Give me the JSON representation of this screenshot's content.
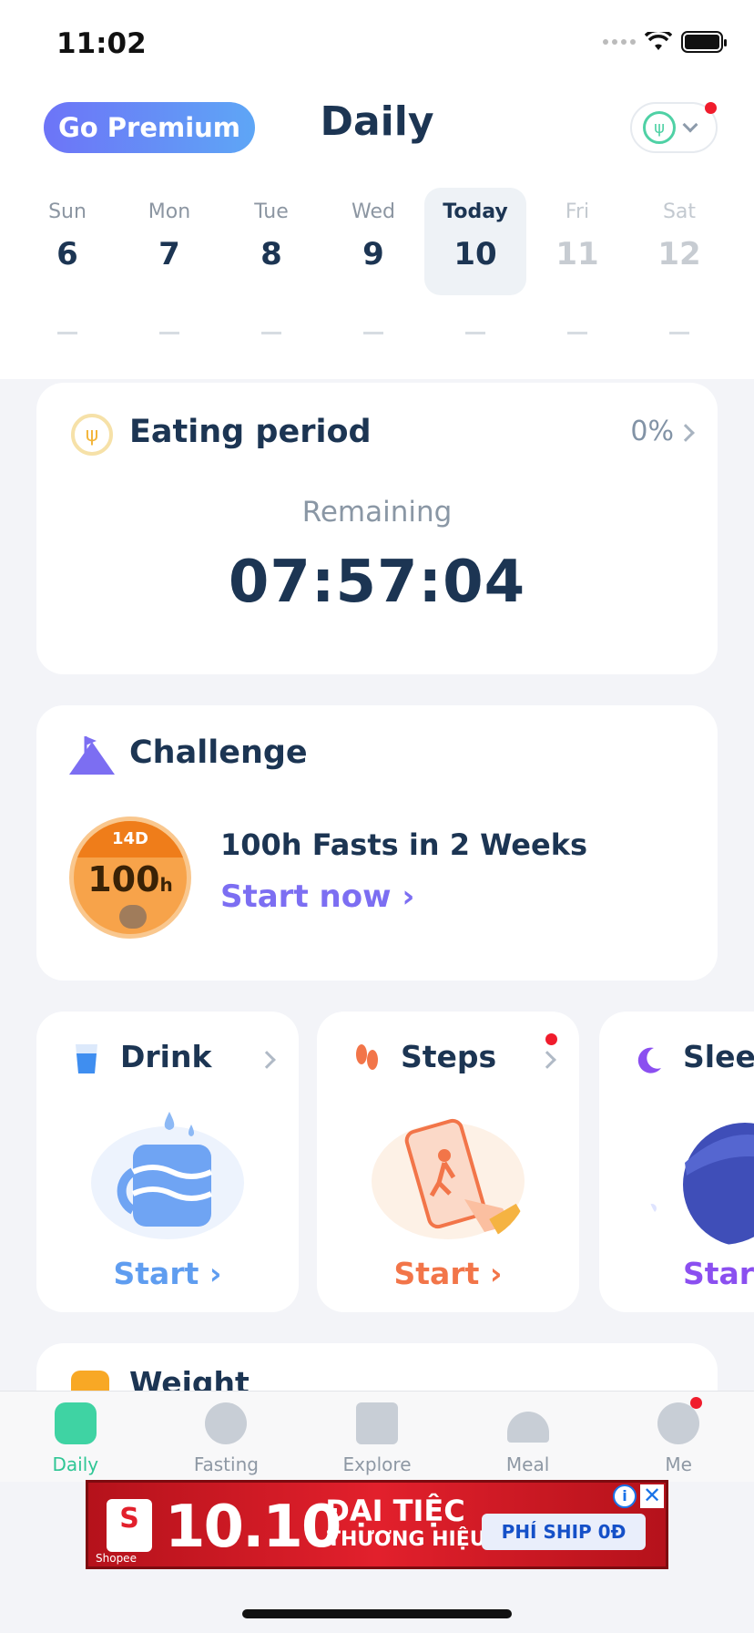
{
  "status_bar": {
    "time": "11:02"
  },
  "header": {
    "premium_label": "Go Premium",
    "title": "Daily"
  },
  "week": [
    {
      "name": "Sun",
      "num": "6",
      "state": "past"
    },
    {
      "name": "Mon",
      "num": "7",
      "state": "past"
    },
    {
      "name": "Tue",
      "num": "8",
      "state": "past"
    },
    {
      "name": "Wed",
      "num": "9",
      "state": "past"
    },
    {
      "name": "Today",
      "num": "10",
      "state": "today"
    },
    {
      "name": "Fri",
      "num": "11",
      "state": "future"
    },
    {
      "name": "Sat",
      "num": "12",
      "state": "future"
    }
  ],
  "eating": {
    "title": "Eating period",
    "percent": "0%",
    "remaining_label": "Remaining",
    "timer": "07:57:04"
  },
  "challenge": {
    "title": "Challenge",
    "badge_top": "14D",
    "badge_value": "100",
    "badge_unit": "h",
    "name": "100h Fasts in 2 Weeks",
    "cta": "Start now ›"
  },
  "trackers": [
    {
      "title": "Drink",
      "cta": "Start ›"
    },
    {
      "title": "Steps",
      "cta": "Start ›"
    },
    {
      "title": "Sleep",
      "cta": "Start"
    }
  ],
  "weight": {
    "title": "Weight"
  },
  "tabs": [
    {
      "label": "Daily",
      "active": true
    },
    {
      "label": "Fasting",
      "active": false
    },
    {
      "label": "Explore",
      "active": false
    },
    {
      "label": "Meal",
      "active": false
    },
    {
      "label": "Me",
      "active": false
    }
  ],
  "ad": {
    "shop_letter": "S",
    "shop_name": "Shopee",
    "date": "10.10",
    "line1": "ĐẠI TIỆC",
    "line2": "THƯƠNG HIỆU",
    "ship": "PHÍ SHIP 0Đ",
    "info": "i",
    "close": "✕"
  },
  "colors": {
    "accent_green": "#3fd3a3",
    "accent_purple": "#7c6ef2",
    "text_dark": "#1c3553",
    "notification_red": "#f01c2c"
  }
}
